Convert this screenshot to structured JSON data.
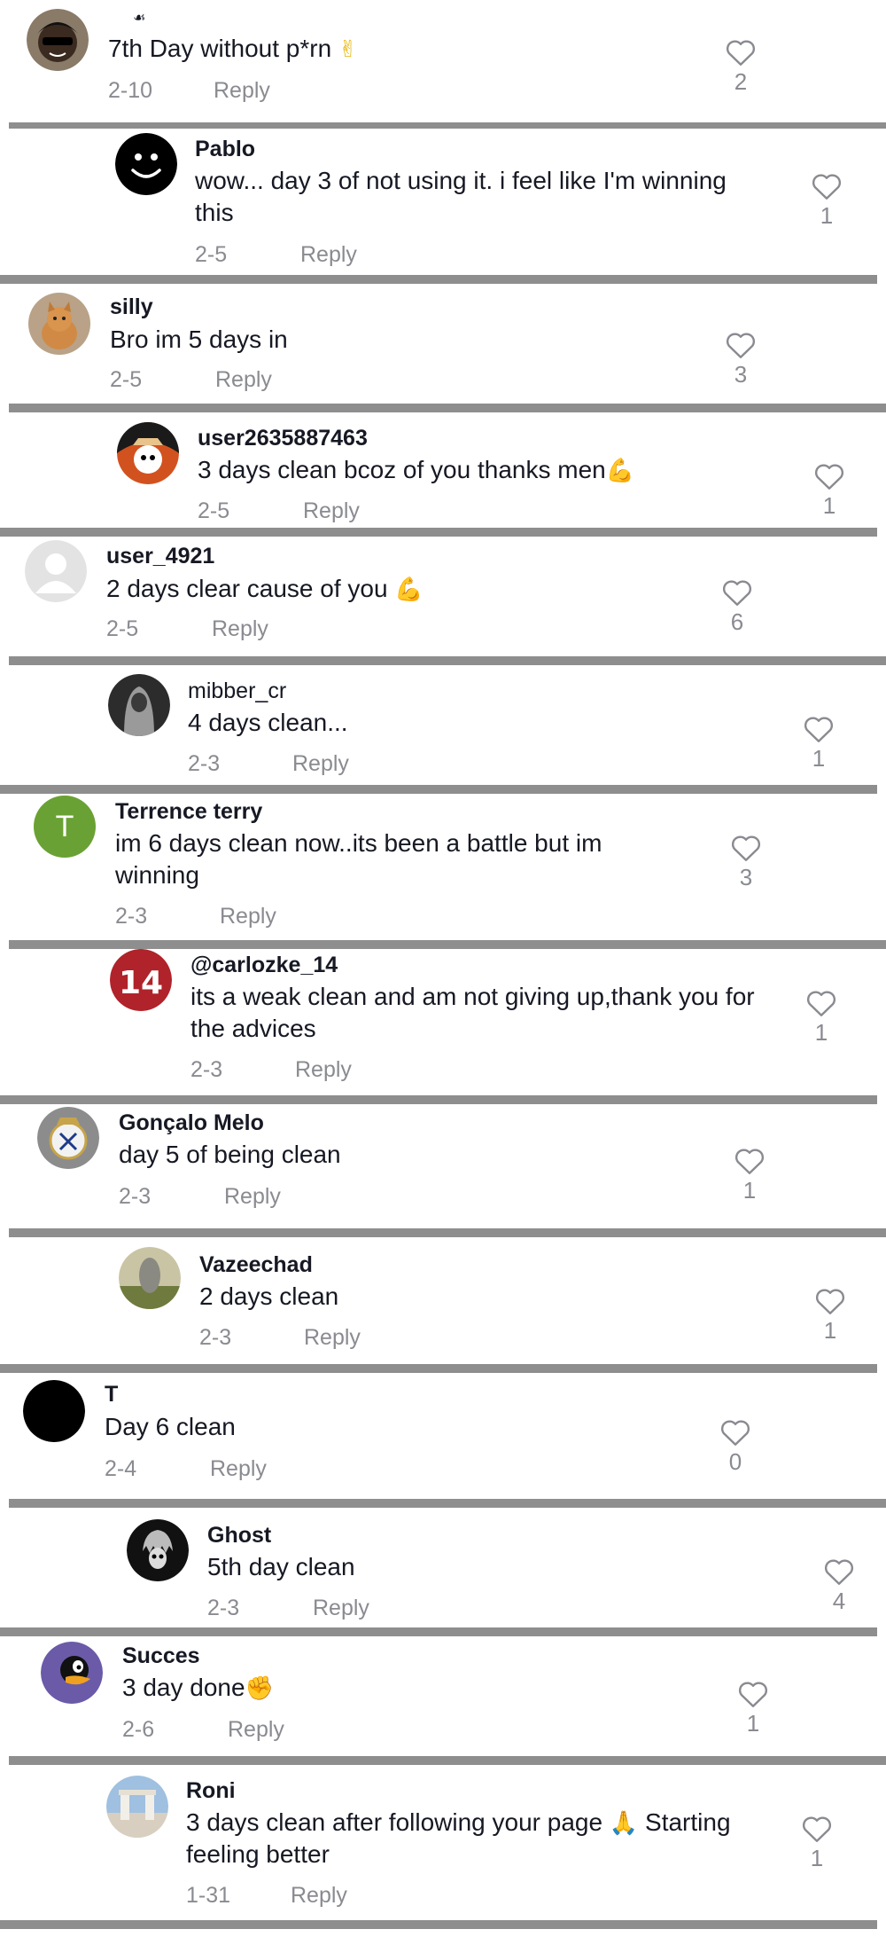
{
  "comments": [
    {
      "user": "",
      "top_icon": "☙",
      "text": "7th Day without p*rn",
      "emoji": "✌",
      "date": "2-10",
      "reply": "Reply",
      "likes": "2",
      "avatar_icon": "cartoon-avatar-icon",
      "avatar_color": "#3a3a3a"
    },
    {
      "user": "Pablo",
      "text": "wow... day 3 of not using it. i feel like I'm winning this",
      "emoji": "",
      "date": "2-5",
      "reply": "Reply",
      "likes": "1",
      "avatar_icon": "smiley-avatar-icon",
      "avatar_color": "#000000"
    },
    {
      "user": "silly",
      "text": "Bro im 5 days in",
      "emoji": "",
      "date": "2-5",
      "reply": "Reply",
      "likes": "3",
      "avatar_icon": "cat-avatar-icon",
      "avatar_color": "#c89868"
    },
    {
      "user": "user2635887463",
      "text": "3 days clean bcoz of you thanks men",
      "emoji": "💪",
      "date": "2-5",
      "reply": "Reply",
      "likes": "1",
      "avatar_icon": "ball-avatar-icon",
      "avatar_color": "#d2521f"
    },
    {
      "user": "user_4921",
      "text": "2 days clear cause of you",
      "emoji": "💪",
      "date": "2-5",
      "reply": "Reply",
      "likes": "6",
      "avatar_icon": "default-avatar-icon",
      "avatar_color": "#e3e3e3"
    },
    {
      "user": "mibber_cr",
      "text": "4 days clean...",
      "emoji": "",
      "date": "2-3",
      "reply": "Reply",
      "likes": "1",
      "avatar_icon": "hooded-figure-avatar-icon",
      "avatar_color": "#4a4a4a"
    },
    {
      "user": "Terrence terry",
      "text": "im 6 days clean now..its been a battle but im winning",
      "emoji": "",
      "date": "2-3",
      "reply": "Reply",
      "likes": "3",
      "avatar_icon": "letter-avatar-icon",
      "avatar_letter": "T",
      "avatar_color": "#6aa134"
    },
    {
      "user": "@carlozke_14",
      "text": "its a weak clean and am not giving up,thank you for the advices",
      "emoji": "",
      "date": "2-3",
      "reply": "Reply",
      "likes": "1",
      "avatar_icon": "jersey-avatar-icon",
      "avatar_color": "#b0232a"
    },
    {
      "user": "Gonçalo Melo",
      "text": "day 5 of being clean",
      "emoji": "",
      "date": "2-3",
      "reply": "Reply",
      "likes": "1",
      "avatar_icon": "crest-avatar-icon",
      "avatar_color": "#8c8c8c"
    },
    {
      "user": "Vazeechad",
      "text": "2 days clean",
      "emoji": "",
      "date": "2-3",
      "reply": "Reply",
      "likes": "1",
      "avatar_icon": "statue-avatar-icon",
      "avatar_color": "#8f9473"
    },
    {
      "user": "T",
      "text": "Day 6 clean",
      "emoji": "",
      "date": "2-4",
      "reply": "Reply",
      "likes": "0",
      "avatar_icon": "black-avatar-icon",
      "avatar_color": "#000000"
    },
    {
      "user": "Ghost",
      "text": "5th day clean",
      "emoji": "",
      "date": "2-3",
      "reply": "Reply",
      "likes": "4",
      "avatar_icon": "ghost-avatar-icon",
      "avatar_color": "#111111"
    },
    {
      "user": "Succes",
      "text": "3 day done",
      "emoji": "✊",
      "date": "2-6",
      "reply": "Reply",
      "likes": "1",
      "avatar_icon": "duck-avatar-icon",
      "avatar_color": "#6b5aa8"
    },
    {
      "user": "Roni",
      "text": "3 days clean after following your page",
      "emoji": "🙏",
      "text_after": "Starting feeling better",
      "date": "1-31",
      "reply": "Reply",
      "likes": "1",
      "avatar_icon": "landscape-avatar-icon",
      "avatar_color": "#7fa0c0"
    }
  ]
}
